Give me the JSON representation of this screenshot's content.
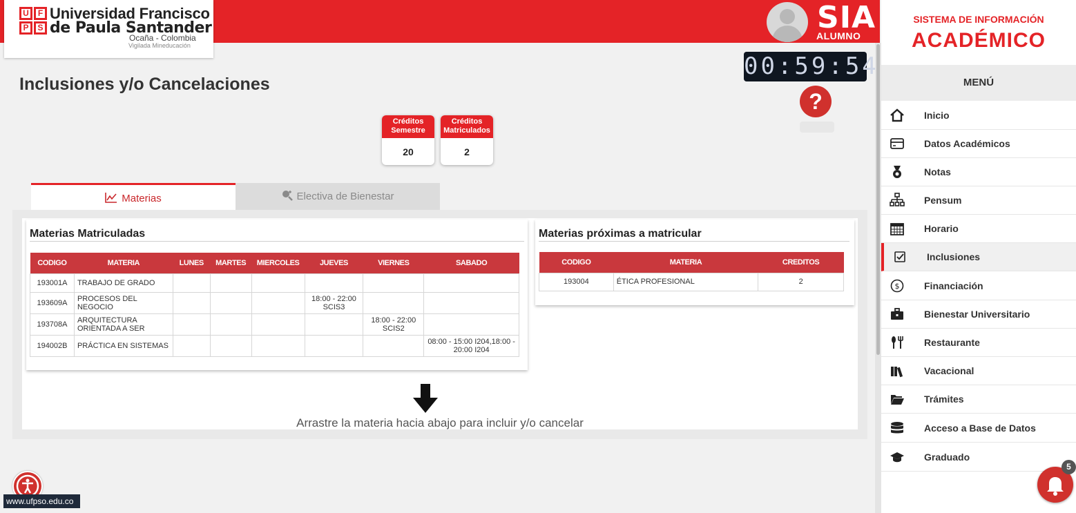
{
  "header": {
    "logo_mark": [
      "U",
      "F",
      "P",
      "S"
    ],
    "logo_line1": "Universidad Francisco",
    "logo_line2": "de Paula Santander",
    "logo_line3": "Ocaña - Colombia",
    "logo_line4": "Vigilada Mineducación",
    "app_title": "SIA",
    "app_subtitle": "ALUMNO",
    "timer": "00:59:54",
    "help": "?",
    "accent": "#e42327"
  },
  "page": {
    "title": "Inclusiones y/o Cancelaciones",
    "credits": [
      {
        "label1": "Créditos",
        "label2": "Semestre",
        "value": "20"
      },
      {
        "label1": "Créditos",
        "label2": "Matriculados",
        "value": "2"
      }
    ],
    "tabs": [
      {
        "label": "Materias",
        "icon": "chart-line-icon",
        "active": true
      },
      {
        "label": "Electiva de Bienestar",
        "icon": "search-plus-icon",
        "active": false
      }
    ],
    "drag_hint": "Arrastre la materia hacia abajo para incluir y/o cancelar"
  },
  "enrolled": {
    "title": "Materias Matriculadas",
    "headers": [
      "CODIGO",
      "MATERIA",
      "LUNES",
      "MARTES",
      "MIERCOLES",
      "JUEVES",
      "VIERNES",
      "SABADO"
    ],
    "rows": [
      {
        "codigo": "193001A",
        "materia": "TRABAJO DE GRADO",
        "lunes": "",
        "martes": "",
        "miercoles": "",
        "jueves": "",
        "viernes": "",
        "sabado": ""
      },
      {
        "codigo": "193609A",
        "materia": "PROCESOS DEL NEGOCIO",
        "lunes": "",
        "martes": "",
        "miercoles": "",
        "jueves": "18:00 - 22:00 SCIS3",
        "viernes": "",
        "sabado": ""
      },
      {
        "codigo": "193708A",
        "materia": "ARQUITECTURA ORIENTADA A SER",
        "lunes": "",
        "martes": "",
        "miercoles": "",
        "jueves": "",
        "viernes": "18:00 - 22:00 SCIS2",
        "sabado": ""
      },
      {
        "codigo": "194002B",
        "materia": "PRÁCTICA EN SISTEMAS",
        "lunes": "",
        "martes": "",
        "miercoles": "",
        "jueves": "",
        "viernes": "",
        "sabado": "08:00 - 15:00 I204,18:00 - 20:00 I204"
      }
    ]
  },
  "upcoming": {
    "title": "Materias próximas a matricular",
    "headers": [
      "CODIGO",
      "MATERIA",
      "CREDITOS"
    ],
    "rows": [
      {
        "codigo": "193004",
        "materia": "ÉTICA PROFESIONAL",
        "creditos": "2"
      }
    ]
  },
  "footer": {
    "url": "www.ufpso.edu.co",
    "notifications": "5"
  },
  "sidebar": {
    "title1": "SISTEMA DE INFORMACIÓN",
    "title2": "ACADÉMICO",
    "menu_header": "MENÚ",
    "items": [
      {
        "label": "Inicio",
        "icon": "home-icon"
      },
      {
        "label": "Datos Académicos",
        "icon": "id-card-icon"
      },
      {
        "label": "Notas",
        "icon": "medal-icon"
      },
      {
        "label": "Pensum",
        "icon": "sitemap-icon"
      },
      {
        "label": "Horario",
        "icon": "calendar-icon"
      },
      {
        "label": "Inclusiones",
        "icon": "checkbox-icon",
        "active": true
      },
      {
        "label": "Financiación",
        "icon": "dollar-circle-icon"
      },
      {
        "label": "Bienestar Universitario",
        "icon": "briefcase-icon"
      },
      {
        "label": "Restaurante",
        "icon": "utensils-icon"
      },
      {
        "label": "Vacacional",
        "icon": "books-icon"
      },
      {
        "label": "Trámites",
        "icon": "folder-open-icon"
      },
      {
        "label": "Acceso a Base de Datos",
        "icon": "database-icon"
      },
      {
        "label": "Graduado",
        "icon": "graduation-cap-icon"
      }
    ]
  }
}
